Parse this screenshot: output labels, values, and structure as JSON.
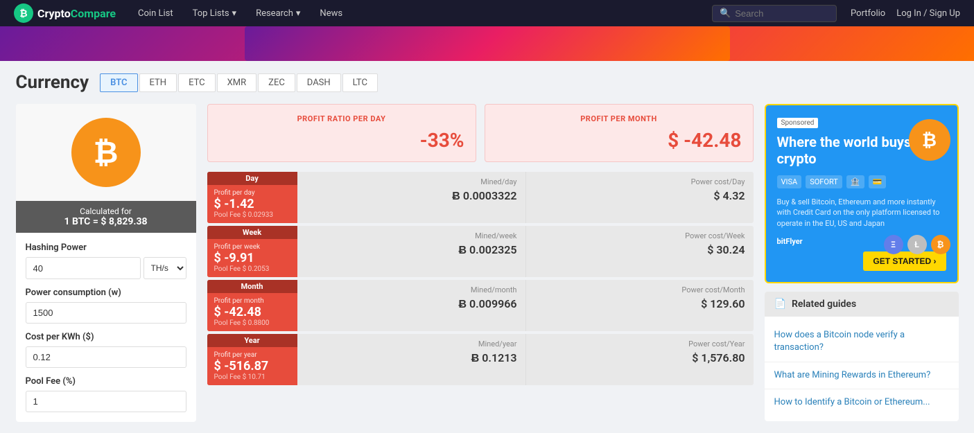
{
  "brand": {
    "icon": "₿",
    "name_crypto": "Crypto",
    "name_compare": "Compare"
  },
  "nav": {
    "links": [
      {
        "id": "coin-list",
        "label": "Coin List",
        "has_dropdown": false
      },
      {
        "id": "top-lists",
        "label": "Top Lists",
        "has_dropdown": true
      },
      {
        "id": "research",
        "label": "Research",
        "has_dropdown": true
      },
      {
        "id": "news",
        "label": "News",
        "has_dropdown": false
      }
    ],
    "search_placeholder": "Search",
    "portfolio": "Portfolio",
    "login": "Log In / Sign Up"
  },
  "page": {
    "title": "Currency",
    "tabs": [
      {
        "id": "btc",
        "label": "BTC",
        "active": true
      },
      {
        "id": "eth",
        "label": "ETH",
        "active": false
      },
      {
        "id": "etc",
        "label": "ETC",
        "active": false
      },
      {
        "id": "xmr",
        "label": "XMR",
        "active": false
      },
      {
        "id": "zec",
        "label": "ZEC",
        "active": false
      },
      {
        "id": "dash",
        "label": "DASH",
        "active": false
      },
      {
        "id": "ltc",
        "label": "LTC",
        "active": false
      }
    ]
  },
  "left": {
    "coin_symbol": "₿",
    "calc_label": "Calculated for",
    "calc_value": "1 BTC = $ 8,829.38",
    "inputs": [
      {
        "id": "hashing-power",
        "label": "Hashing Power",
        "value": "40",
        "unit": "TH/s"
      },
      {
        "id": "power-consumption",
        "label": "Power consumption (w)",
        "value": "1500",
        "unit": null
      },
      {
        "id": "cost-per-kwh",
        "label": "Cost per KWh ($)",
        "value": "0.12",
        "unit": null
      },
      {
        "id": "pool-fee",
        "label": "Pool Fee (%)",
        "value": "1",
        "unit": null
      }
    ]
  },
  "summary": {
    "profit_ratio_label": "PROFIT RATIO PER DAY",
    "profit_ratio_value": "-33%",
    "profit_month_label": "PROFIT PER MONTH",
    "profit_month_value": "$ -42.48"
  },
  "rows": [
    {
      "period": "Day",
      "profit_label": "Profit per day",
      "profit_value": "$ -1.42",
      "pool_fee": "Pool Fee $ 0.02933",
      "mined_label": "Mined/day",
      "mined_value": "Ƀ 0.0003322",
      "power_label": "Power cost/Day",
      "power_value": "$ 4.32"
    },
    {
      "period": "Week",
      "profit_label": "Profit per week",
      "profit_value": "$ -9.91",
      "pool_fee": "Pool Fee $ 0.2053",
      "mined_label": "Mined/week",
      "mined_value": "Ƀ 0.002325",
      "power_label": "Power cost/Week",
      "power_value": "$ 30.24"
    },
    {
      "period": "Month",
      "profit_label": "Profit per month",
      "profit_value": "$ -42.48",
      "pool_fee": "Pool Fee $ 0.8800",
      "mined_label": "Mined/month",
      "mined_value": "Ƀ 0.009966",
      "power_label": "Power cost/Month",
      "power_value": "$ 129.60"
    },
    {
      "period": "Year",
      "profit_label": "Profit per year",
      "profit_value": "$ -516.87",
      "pool_fee": "Pool Fee $ 10.71",
      "mined_label": "Mined/year",
      "mined_value": "Ƀ 0.1213",
      "power_label": "Power cost/Year",
      "power_value": "$ 1,576.80"
    }
  ],
  "ad": {
    "sponsored": "Sponsored",
    "title": "Where the world buys crypto",
    "description": "Buy & sell Bitcoin, Ethereum and more instantly with Credit Card on the only platform licensed to operate in the EU, US and Japan",
    "logos": [
      "VISA",
      "SOFORT"
    ],
    "cta": "GET STARTED ›",
    "provider": "bitFlyer"
  },
  "guides": {
    "header": "Related guides",
    "items": [
      "How does a Bitcoin node verify a transaction?",
      "What are Mining Rewards in Ethereum?",
      "How to Identify a Bitcoin or Ethereum..."
    ]
  }
}
